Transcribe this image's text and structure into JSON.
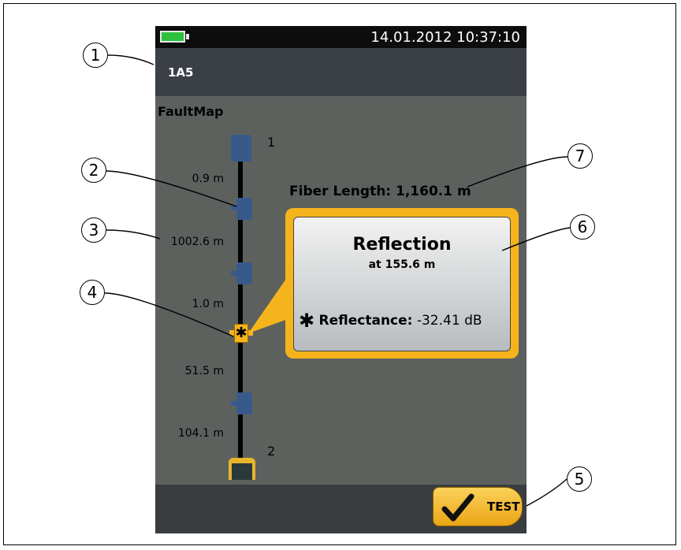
{
  "status": {
    "datetime": "14.01.2012 10:37:10",
    "battery": "full",
    "battery_color": "#2dc13d"
  },
  "header": {
    "id_label": "1A5"
  },
  "faultmap": {
    "title": "FaultMap",
    "end_start": "1",
    "end_remote": "2",
    "segments": [
      "0.9 m",
      "1002.6 m",
      "1.0 m",
      "51.5 m",
      "104.1 m"
    ],
    "connector_color": "#375a8a",
    "event_color": "#f6b41c"
  },
  "fiber_length": "Fiber Length: 1,160.1 m",
  "event_popup": {
    "title": "Reflection",
    "subtitle": "at 155.6 m",
    "reflectance_label": "Reflectance:",
    "reflectance_value": "-32.41 dB",
    "icon": "asterisk-icon"
  },
  "test_button": {
    "label": "TEST",
    "icon": "checkmark-icon"
  },
  "callouts": [
    "1",
    "2",
    "3",
    "4",
    "5",
    "6",
    "7"
  ]
}
